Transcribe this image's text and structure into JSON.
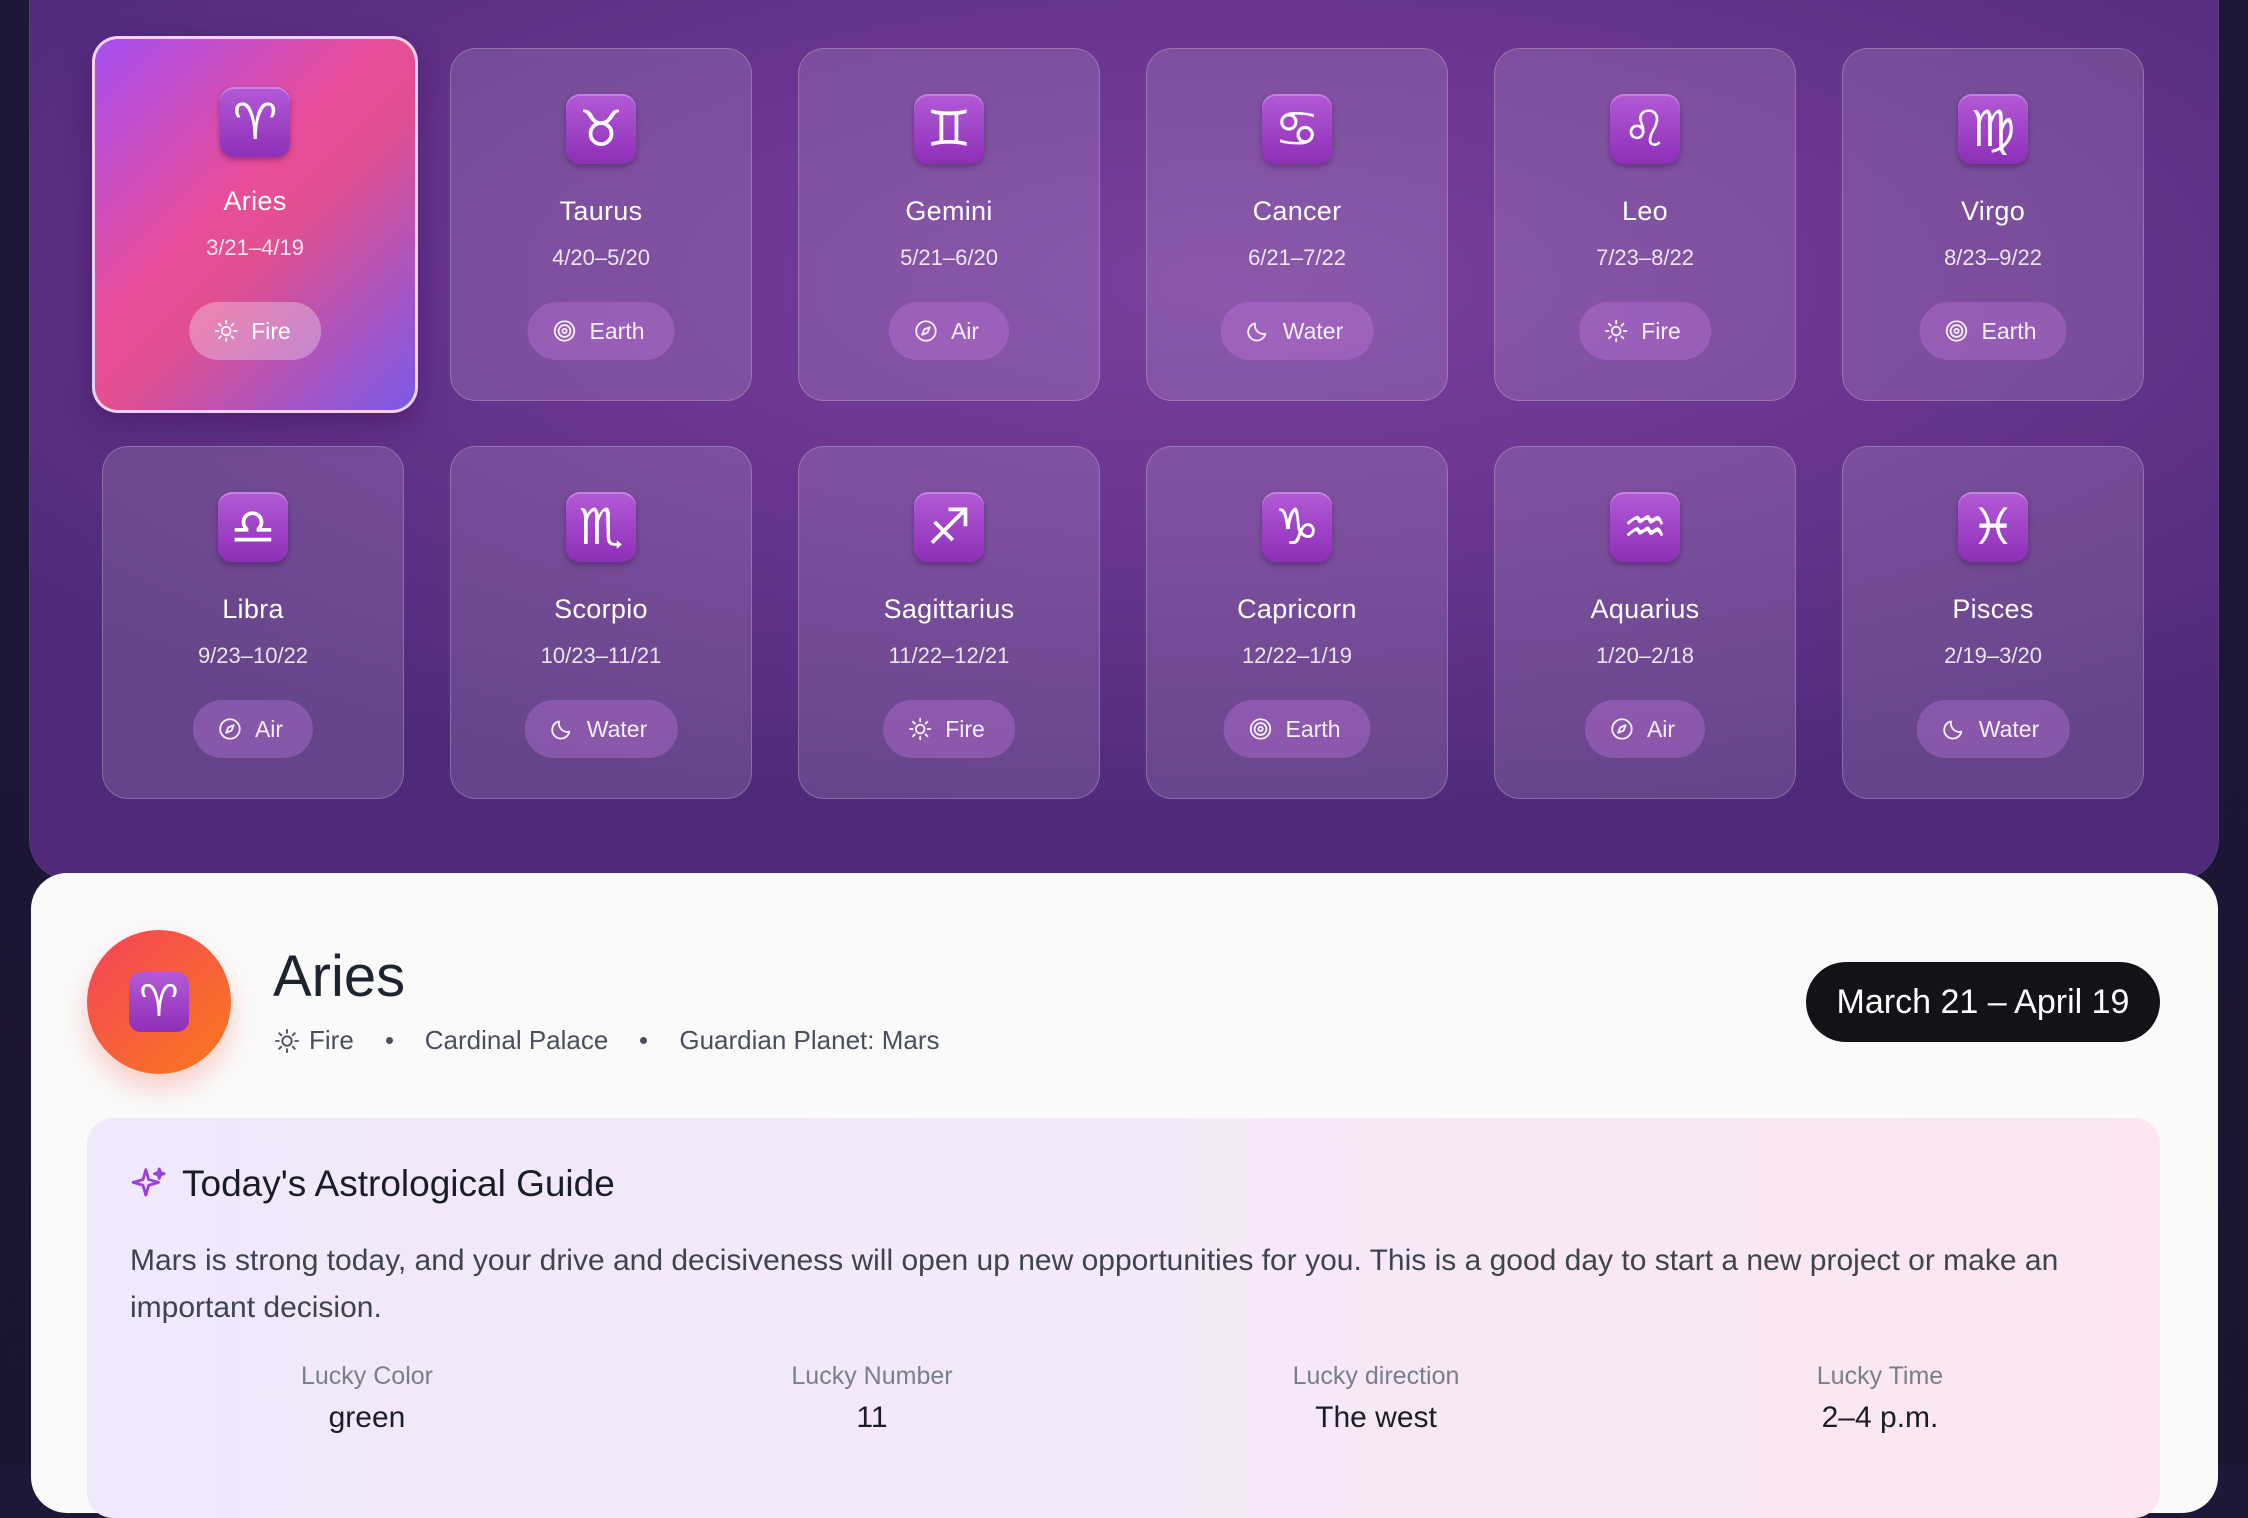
{
  "signs": [
    {
      "name": "Aries",
      "dates": "3/21–4/19",
      "element": "Fire",
      "symbol": "♈",
      "active": true
    },
    {
      "name": "Taurus",
      "dates": "4/20–5/20",
      "element": "Earth",
      "symbol": "♉"
    },
    {
      "name": "Gemini",
      "dates": "5/21–6/20",
      "element": "Air",
      "symbol": "♊"
    },
    {
      "name": "Cancer",
      "dates": "6/21–7/22",
      "element": "Water",
      "symbol": "♋"
    },
    {
      "name": "Leo",
      "dates": "7/23–8/22",
      "element": "Fire",
      "symbol": "♌"
    },
    {
      "name": "Virgo",
      "dates": "8/23–9/22",
      "element": "Earth",
      "symbol": "♍"
    },
    {
      "name": "Libra",
      "dates": "9/23–10/22",
      "element": "Air",
      "symbol": "♎"
    },
    {
      "name": "Scorpio",
      "dates": "10/23–11/21",
      "element": "Water",
      "symbol": "♏"
    },
    {
      "name": "Sagittarius",
      "dates": "11/22–12/21",
      "element": "Fire",
      "symbol": "♐"
    },
    {
      "name": "Capricorn",
      "dates": "12/22–1/19",
      "element": "Earth",
      "symbol": "♑"
    },
    {
      "name": "Aquarius",
      "dates": "1/20–2/18",
      "element": "Air",
      "symbol": "♒"
    },
    {
      "name": "Pisces",
      "dates": "2/19–3/20",
      "element": "Water",
      "symbol": "♓"
    }
  ],
  "element_icons": {
    "Fire": "sun-icon",
    "Earth": "target-icon",
    "Air": "compass-icon",
    "Water": "moon-icon"
  },
  "detail": {
    "symbol": "♈",
    "name": "Aries",
    "element": "Fire",
    "palace": "Cardinal Palace",
    "planet": "Guardian Planet: Mars",
    "date_range": "March 21 – April 19"
  },
  "guide": {
    "title": "Today's Astrological Guide",
    "text": "Mars is strong today, and your drive and decisiveness will open up new opportunities for you. This is a good day to start a new project or make an important decision.",
    "lucky": [
      {
        "label": "Lucky Color",
        "value": "green"
      },
      {
        "label": "Lucky Number",
        "value": "11"
      },
      {
        "label": "Lucky direction",
        "value": "The west"
      },
      {
        "label": "Lucky Time",
        "value": "2–4 p.m."
      }
    ]
  },
  "colors": {
    "accent_purple": "#8e2fb8",
    "badge_dark": "#121217",
    "icon_orange": "#f97a1c",
    "icon_red": "#f4435a"
  }
}
